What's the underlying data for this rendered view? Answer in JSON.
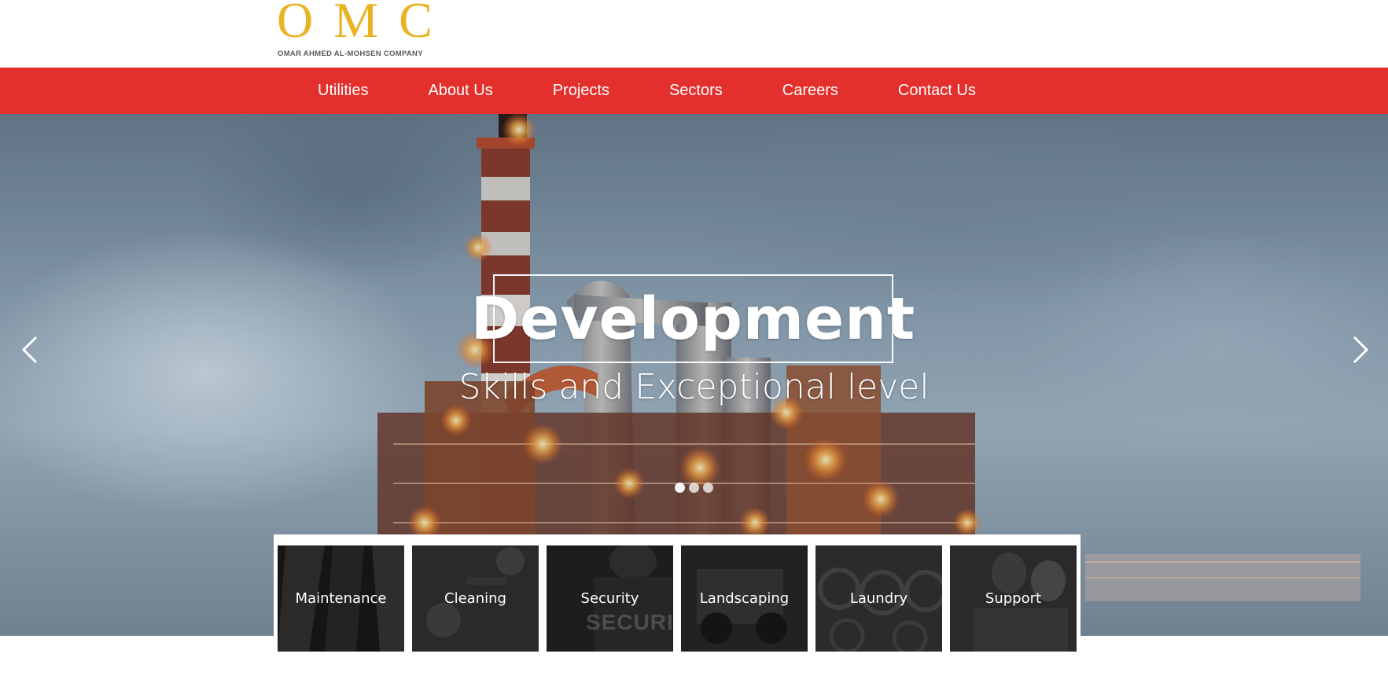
{
  "logo": {
    "mark": "OMC",
    "subtitle": "OMAR AHMED AL-MOHSEN COMPANY"
  },
  "nav": {
    "items": [
      {
        "label": "Utilities"
      },
      {
        "label": "About Us"
      },
      {
        "label": "Projects"
      },
      {
        "label": "Sectors"
      },
      {
        "label": "Careers"
      },
      {
        "label": "Contact Us"
      }
    ]
  },
  "hero": {
    "title": "Development",
    "subtitle": "Skills and Exceptional level",
    "slide_count": 3,
    "active_slide": 1,
    "prev_icon": "chevron-left-icon",
    "next_icon": "chevron-right-icon"
  },
  "services": {
    "tiles": [
      {
        "label": "Maintenance"
      },
      {
        "label": "Cleaning"
      },
      {
        "label": "Security",
        "background_text": "SECURITY"
      },
      {
        "label": "Landscaping"
      },
      {
        "label": "Laundry"
      },
      {
        "label": "Support"
      }
    ]
  },
  "colors": {
    "nav_background": "#e3302c",
    "logo_gold": "#e9b325",
    "tile_background": "#1f1f1f"
  }
}
